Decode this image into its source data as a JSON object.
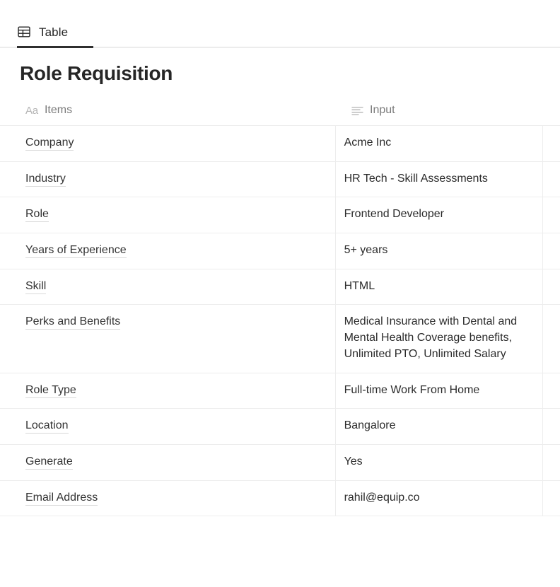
{
  "tabs": [
    {
      "label": "Table",
      "icon": "table-grid-icon",
      "active": true
    }
  ],
  "page_title": "Role Requisition",
  "table": {
    "columns": [
      {
        "key": "items",
        "label": "Items",
        "icon": "aa-text-icon",
        "icon_glyph": "Aa"
      },
      {
        "key": "input",
        "label": "Input",
        "icon": "text-lines-icon"
      }
    ],
    "rows": [
      {
        "item": "Company",
        "input": "Acme Inc"
      },
      {
        "item": "Industry",
        "input": "HR Tech - Skill Assessments"
      },
      {
        "item": "Role",
        "input": "Frontend Developer"
      },
      {
        "item": "Years of Experience",
        "input": "5+ years"
      },
      {
        "item": "Skill",
        "input": "HTML"
      },
      {
        "item": "Perks and Benefits",
        "input": "Medical Insurance with Dental and Mental Health Coverage benefits, Unlimited PTO, Unlimited Salary"
      },
      {
        "item": "Role Type",
        "input": "Full-time Work From Home"
      },
      {
        "item": "Location",
        "input": "Bangalore"
      },
      {
        "item": "Generate",
        "input": "Yes"
      },
      {
        "item": "Email Address",
        "input": "rahil@equip.co"
      }
    ]
  },
  "colors": {
    "text": "#333333",
    "muted": "#7b7b7b",
    "icon_muted": "#b4b4b4",
    "border": "#ededed",
    "active_tab": "#2f2f2f"
  }
}
